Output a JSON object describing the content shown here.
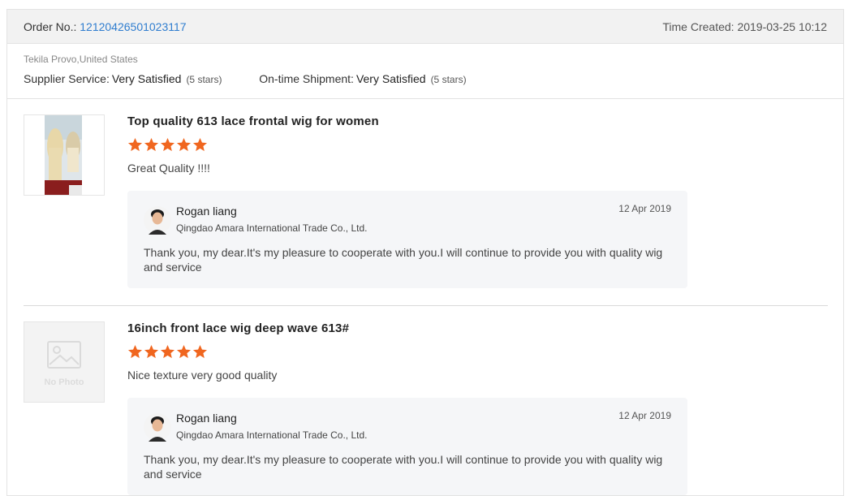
{
  "order": {
    "label": "Order No.:",
    "number": "12120426501023117",
    "time_label": "Time Created:",
    "time_value": "2019-03-25 10:12"
  },
  "buyer": {
    "location": "Tekila Provo,United States",
    "supplier_service_label": "Supplier Service:",
    "supplier_service_value": "Very Satisfied",
    "supplier_service_stars": "(5 stars)",
    "shipment_label": "On-time Shipment:",
    "shipment_value": "Very Satisfied",
    "shipment_stars": "(5 stars)"
  },
  "items": [
    {
      "product_name": "Top quality 613 lace frontal wig for women",
      "rating": 5,
      "review": "Great Quality !!!!",
      "reply": {
        "name": "Rogan liang",
        "company": "Qingdao Amara International Trade Co., Ltd.",
        "date": "12 Apr 2019",
        "text": "Thank you, my dear.It's my pleasure to cooperate with you.I will continue to provide you with quality wig and service"
      }
    },
    {
      "product_name": "16inch front lace wig deep wave 613#",
      "rating": 5,
      "review": "Nice texture very good quality",
      "no_photo_text": "No Photo",
      "reply": {
        "name": "Rogan liang",
        "company": "Qingdao Amara International Trade Co., Ltd.",
        "date": "12 Apr 2019",
        "text": "Thank you, my dear.It's my pleasure to cooperate with you.I will continue to provide you with quality wig and service"
      }
    }
  ],
  "colors": {
    "star": "#f0661f",
    "link": "#2f7dcf"
  },
  "icons": [
    "star-icon",
    "avatar",
    "no-photo-icon"
  ]
}
